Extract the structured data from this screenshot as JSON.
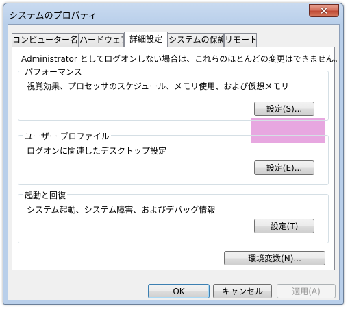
{
  "window": {
    "title": "システムのプロパティ"
  },
  "tabs": [
    {
      "label": "コンピューター名"
    },
    {
      "label": "ハードウェア"
    },
    {
      "label": "詳細設定"
    },
    {
      "label": "システムの保護"
    },
    {
      "label": "リモート"
    }
  ],
  "notice": "Administrator としてログオンしない場合は、これらのほとんどの変更はできません。",
  "groups": {
    "performance": {
      "title": "パフォーマンス",
      "description": "視覚効果、プロセッサのスケジュール、メモリ使用、および仮想メモリ",
      "button": "設定(S)..."
    },
    "user_profile": {
      "title": "ユーザー プロファイル",
      "description": "ログオンに関連したデスクトップ設定",
      "button": "設定(E)..."
    },
    "startup_recovery": {
      "title": "起動と回復",
      "description": "システム起動、システム障害、およびデバッグ情報",
      "button": "設定(T)"
    }
  },
  "env_button": "環境変数(N)...",
  "dialog_buttons": {
    "ok": "OK",
    "cancel": "キャンセル",
    "apply": "適用(A)"
  },
  "colors": {
    "highlight": "#e7a7e0",
    "close_button": "#c04a35"
  }
}
